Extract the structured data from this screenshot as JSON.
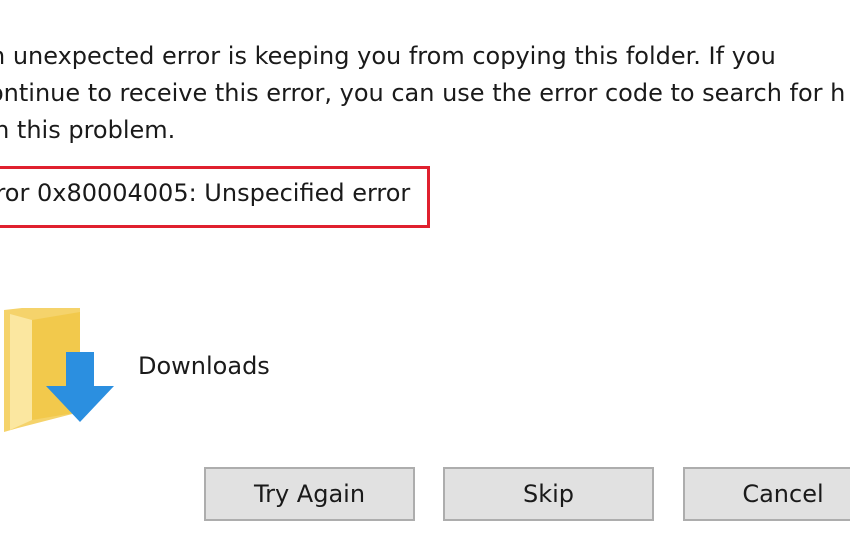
{
  "dialog": {
    "message_lines": [
      "n unexpected error is keeping you from copying this folder. If you",
      "ontinue to receive this error, you can use the error code to search for h",
      "ith this problem."
    ],
    "error_text": "rror 0x80004005: Unspecified error",
    "item": {
      "name": "Downloads",
      "icon": "downloads-folder-icon"
    },
    "buttons": {
      "try_again": "Try Again",
      "skip": "Skip",
      "cancel": "Cancel"
    }
  },
  "colors": {
    "highlight_border": "#e0202e",
    "button_bg": "#e1e1e1",
    "button_border": "#adadad",
    "folder_yellow": "#f5d36b",
    "arrow_blue": "#2b8fe0"
  }
}
